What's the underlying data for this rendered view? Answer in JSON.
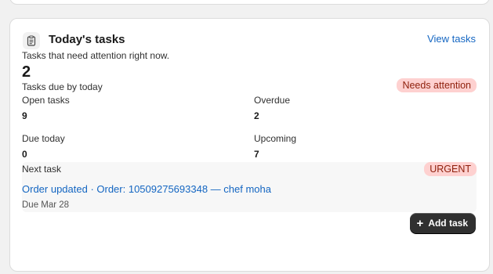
{
  "card": {
    "title": "Today's tasks",
    "view_link": "View tasks",
    "subtitle": "Tasks that need attention right now.",
    "due_count": "2",
    "due_caption": "Tasks due by today",
    "attention_badge": "Needs attention"
  },
  "stats": {
    "open": {
      "label": "Open tasks",
      "value": "9"
    },
    "overdue": {
      "label": "Overdue",
      "value": "2"
    },
    "due_today": {
      "label": "Due today",
      "value": "0"
    },
    "upcoming": {
      "label": "Upcoming",
      "value": "7"
    }
  },
  "next_task": {
    "label": "Next task",
    "priority": "URGENT",
    "link": "Order updated · Order: 10509275693348 — chef moha",
    "due": "Due Mar 28"
  },
  "actions": {
    "add_task": "Add task"
  },
  "icons": {
    "header": "clipboard-icon",
    "add": "plus-icon"
  },
  "colors": {
    "link": "#1466c2",
    "badge_bg": "#fed1d0",
    "badge_text": "#8e1f0b",
    "button_bg": "#303030"
  }
}
